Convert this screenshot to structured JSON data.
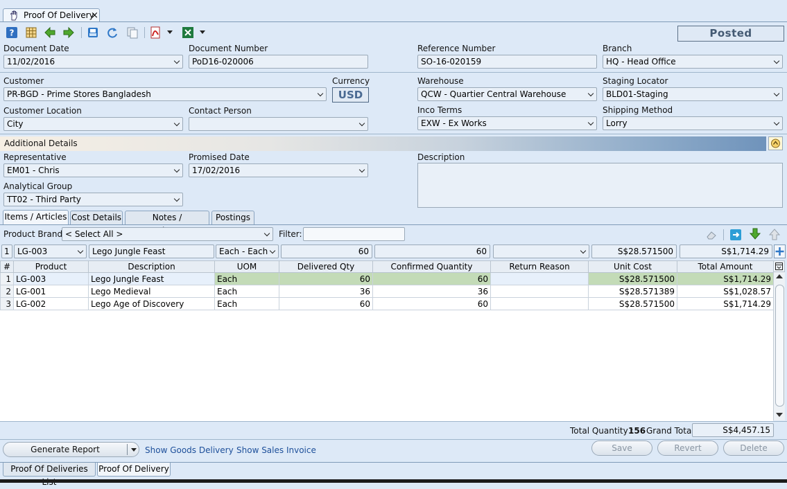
{
  "window": {
    "tab_title": "Proof Of Delivery",
    "close_glyph": "×"
  },
  "toolbar": {
    "icons": [
      "help-icon",
      "grid-icon",
      "back-arrow-icon",
      "forward-arrow-icon",
      "print-icon",
      "refresh-icon",
      "copy-icon",
      "pdf-icon",
      "excel-icon"
    ]
  },
  "status": "Posted",
  "header": {
    "document_date_label": "Document Date",
    "document_date": "11/02/2016",
    "document_number_label": "Document Number",
    "document_number": "PoD16-020006",
    "reference_number_label": "Reference Number",
    "reference_number": "SO-16-020159",
    "branch_label": "Branch",
    "branch": "HQ - Head Office",
    "customer_label": "Customer",
    "customer": "PR-BGD - Prime Stores Bangladesh",
    "currency_label": "Currency",
    "currency": "USD",
    "warehouse_label": "Warehouse",
    "warehouse": "QCW - Quartier Central Warehouse",
    "staging_locator_label": "Staging Locator",
    "staging_locator": "BLD01-Staging",
    "customer_location_label": "Customer Location",
    "customer_location": "City",
    "contact_person_label": "Contact Person",
    "contact_person": "",
    "inco_terms_label": "Inco Terms",
    "inco_terms": "EXW - Ex Works",
    "shipping_method_label": "Shipping Method",
    "shipping_method": "Lorry"
  },
  "additional": {
    "title": "Additional Details",
    "representative_label": "Representative",
    "representative": "EM01 - Chris",
    "promised_date_label": "Promised Date",
    "promised_date": "17/02/2016",
    "description_label": "Description",
    "description": "",
    "analytical_group_label": "Analytical Group",
    "analytical_group": "TT02 - Third Party"
  },
  "tabs": [
    "Items / Articles",
    "Cost Details",
    "Notes / Attachments",
    "Postings"
  ],
  "filter_bar": {
    "brand_label": "Product Brand:",
    "brand_value": "< Select All >",
    "filter_label": "Filter:",
    "filter_value": ""
  },
  "entry_row": {
    "num": "1",
    "product": "LG-003",
    "description": "Lego Jungle Feast",
    "uom": "Each - Each",
    "delivered_qty": "60",
    "confirmed_qty": "60",
    "return_reason": "",
    "unit_cost": "S$28.571500",
    "total_amount": "S$1,714.29"
  },
  "grid": {
    "columns": [
      "#",
      "Product",
      "Description",
      "UOM",
      "Delivered Qty",
      "Confirmed Quantity",
      "Return Reason",
      "Unit Cost",
      "Total Amount"
    ],
    "rows": [
      {
        "num": "1",
        "product": "LG-003",
        "description": "Lego Jungle Feast",
        "uom": "Each",
        "delivered": "60",
        "confirmed": "60",
        "reason": "",
        "unit_cost": "S$28.571500",
        "total": "S$1,714.29"
      },
      {
        "num": "2",
        "product": "LG-001",
        "description": "Lego Medieval",
        "uom": "Each",
        "delivered": "36",
        "confirmed": "36",
        "reason": "",
        "unit_cost": "S$28.571389",
        "total": "S$1,028.57"
      },
      {
        "num": "3",
        "product": "LG-002",
        "description": "Lego Age of Discovery",
        "uom": "Each",
        "delivered": "60",
        "confirmed": "60",
        "reason": "",
        "unit_cost": "S$28.571500",
        "total": "S$1,714.29"
      }
    ]
  },
  "totals": {
    "total_quantity_label": "Total Quantity :",
    "total_quantity": "156",
    "grand_total_label": "Grand Total:",
    "grand_total": "S$4,457.15"
  },
  "footer": {
    "generate_report": "Generate Report",
    "show_goods_delivery": "Show Goods Delivery",
    "show_sales_invoice": "Show Sales Invoice",
    "save": "Save",
    "revert": "Revert",
    "delete": "Delete"
  },
  "bottom_tabs": [
    "Proof Of Deliveries List",
    "Proof Of Delivery"
  ],
  "colors": {
    "background": "#dde9f7",
    "status_text": "#445a73",
    "link": "#1d4f9a",
    "selected_green": "#c3dbb7"
  }
}
